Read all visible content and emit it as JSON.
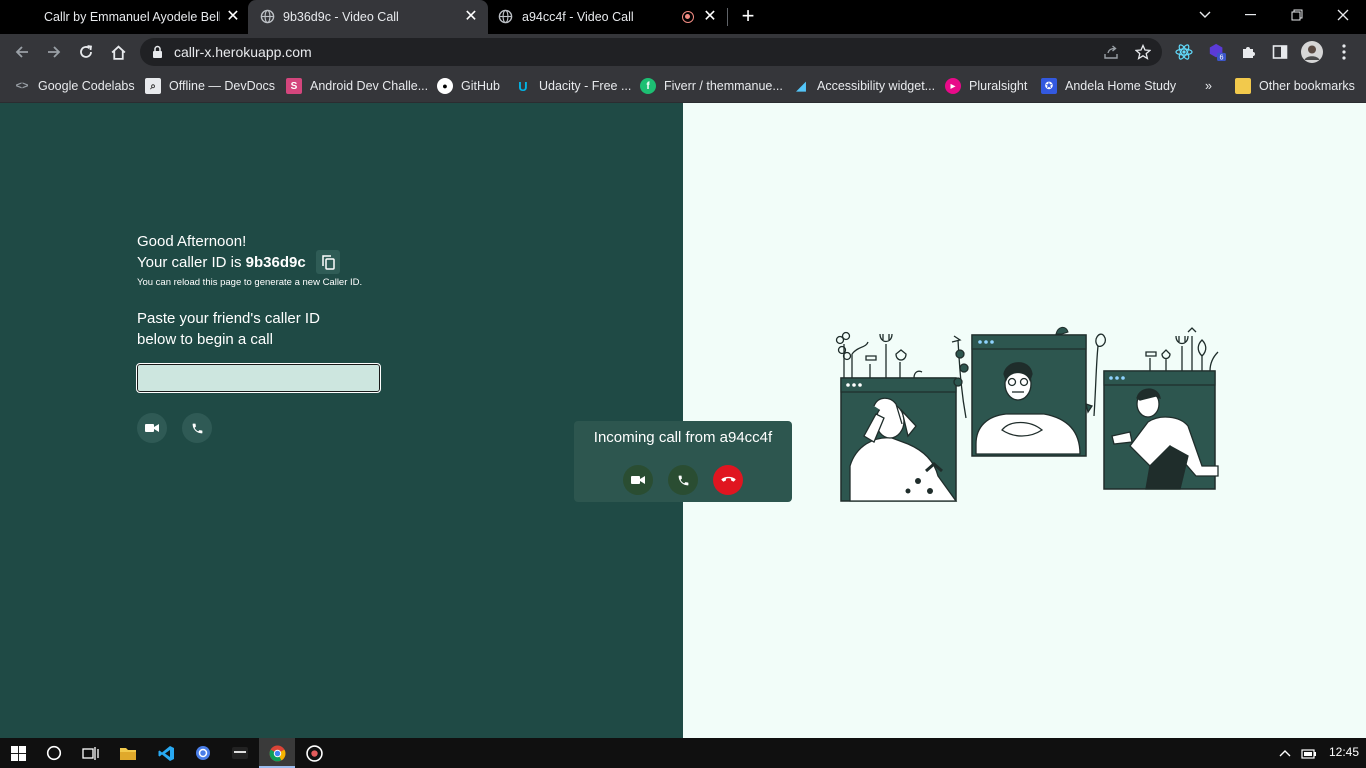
{
  "browser": {
    "tabs": [
      {
        "title": "Callr by Emmanuel Ayodele Bello",
        "active": false
      },
      {
        "title": "9b36d9c - Video Call",
        "active": true
      },
      {
        "title": "a94cc4f - Video Call",
        "active": false,
        "recording": true
      }
    ],
    "address": "callr-x.herokuapp.com",
    "extension_badge": "6",
    "bookmarks": [
      {
        "label": "Google Codelabs",
        "icon": "codelabs-icon"
      },
      {
        "label": "Offline — DevDocs",
        "icon": "devdocs-icon"
      },
      {
        "label": "Android Dev Challe...",
        "icon": "android-challenge-icon"
      },
      {
        "label": "GitHub",
        "icon": "github-icon"
      },
      {
        "label": "Udacity - Free ...",
        "icon": "udacity-icon"
      },
      {
        "label": "Fiverr / themmanue...",
        "icon": "fiverr-icon"
      },
      {
        "label": "Accessibility widget...",
        "icon": "flutter-icon"
      },
      {
        "label": "Pluralsight",
        "icon": "pluralsight-icon"
      },
      {
        "label": "Andela Home Study",
        "icon": "andela-icon"
      }
    ],
    "overflow_label": "»",
    "other_bookmarks": "Other bookmarks"
  },
  "app": {
    "greeting": "Good Afternoon!",
    "caller_prefix": "Your caller ID is",
    "caller_id": "9b36d9c",
    "reload_note": "You can reload this page to generate a new Caller ID.",
    "paste_line1": "Paste your friend's caller ID",
    "paste_line2": "below to begin a call",
    "friend_input_value": "",
    "incoming_message": "Incoming call from a94cc4f"
  },
  "taskbar": {
    "clock": "12:45"
  },
  "colors": {
    "panel_dark": "#1f4a45",
    "panel_light": "#f2fdf9",
    "decline": "#e01520",
    "accept": "#2a4d32"
  }
}
